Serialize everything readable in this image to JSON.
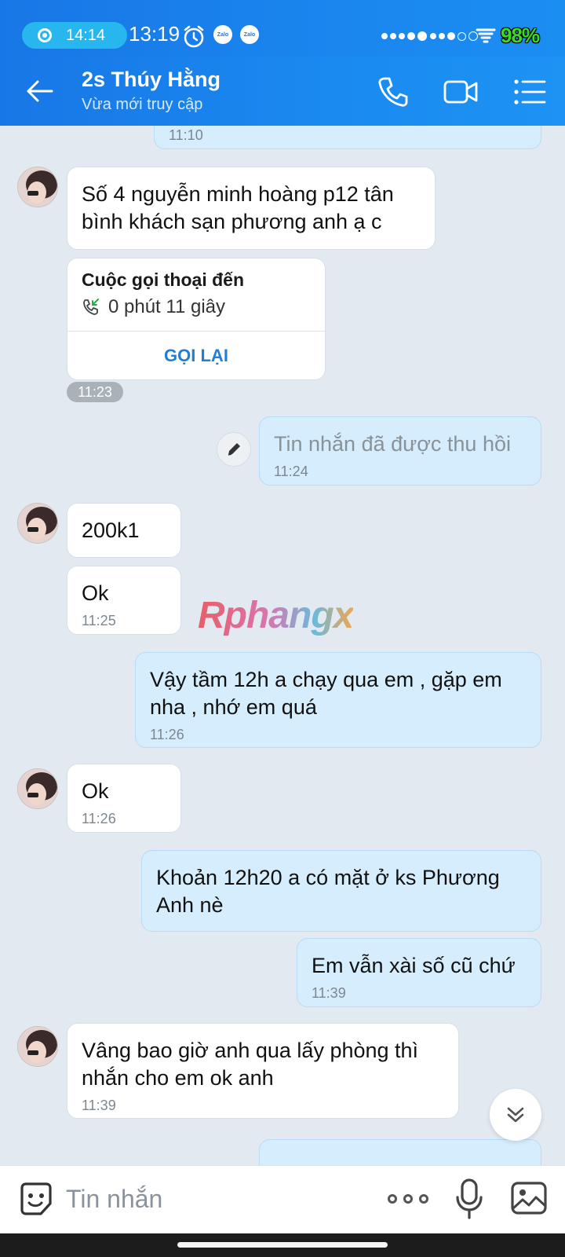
{
  "status_bar": {
    "recording_time": "14:14",
    "clock": "13:19",
    "notification_icons": [
      "alarm-icon",
      "zalo-icon",
      "zalo-icon"
    ],
    "zalo_label": "Zalo",
    "battery": "98%"
  },
  "header": {
    "contact_name": "2s Thúy Hằng",
    "contact_status": "Vừa mới truy cập",
    "icons": [
      "back-arrow-icon",
      "phone-icon",
      "video-camera-icon",
      "menu-icon"
    ]
  },
  "messages": [
    {
      "dir": "out",
      "time": "11:10"
    },
    {
      "dir": "in",
      "text": "Số 4 nguyễn minh hoàng p12 tân bình khách sạn phương anh ạ c"
    },
    {
      "dir": "in",
      "type": "call",
      "title": "Cuộc gọi thoại đến",
      "duration": "0 phút 11 giây",
      "action": "GỌI LẠI",
      "time": "11:23"
    },
    {
      "dir": "out",
      "text": "Tin nhắn đã được thu hồi",
      "time": "11:24",
      "recalled": true
    },
    {
      "dir": "in",
      "text": "200k1"
    },
    {
      "dir": "in",
      "text": "Ok",
      "time": "11:25"
    },
    {
      "dir": "out",
      "text": "Vậy tầm 12h a chạy qua em , gặp em nha , nhớ em quá",
      "time": "11:26"
    },
    {
      "dir": "in",
      "text": "Ok",
      "time": "11:26"
    },
    {
      "dir": "out",
      "text": "Khoản 12h20 a có mặt ở ks Phương Anh nè"
    },
    {
      "dir": "out",
      "text": "Em vẫn xài số cũ chứ",
      "time": "11:39"
    },
    {
      "dir": "in",
      "text": "Vâng bao giờ anh qua lấy phòng thì nhắn cho em ok anh",
      "time": "11:39"
    }
  ],
  "watermark": "Rphangx",
  "input_bar": {
    "placeholder": "Tin nhắn",
    "icons": [
      "sticker-icon",
      "more-icon",
      "microphone-icon",
      "image-icon"
    ]
  },
  "colors": {
    "header": "#1a86ee",
    "chat_background": "#e2e9f1",
    "outgoing_bubble": "#d5edfc",
    "incoming_bubble": "#ffffff",
    "accent": "#1f7fd8",
    "battery": "#3bdc1c"
  }
}
